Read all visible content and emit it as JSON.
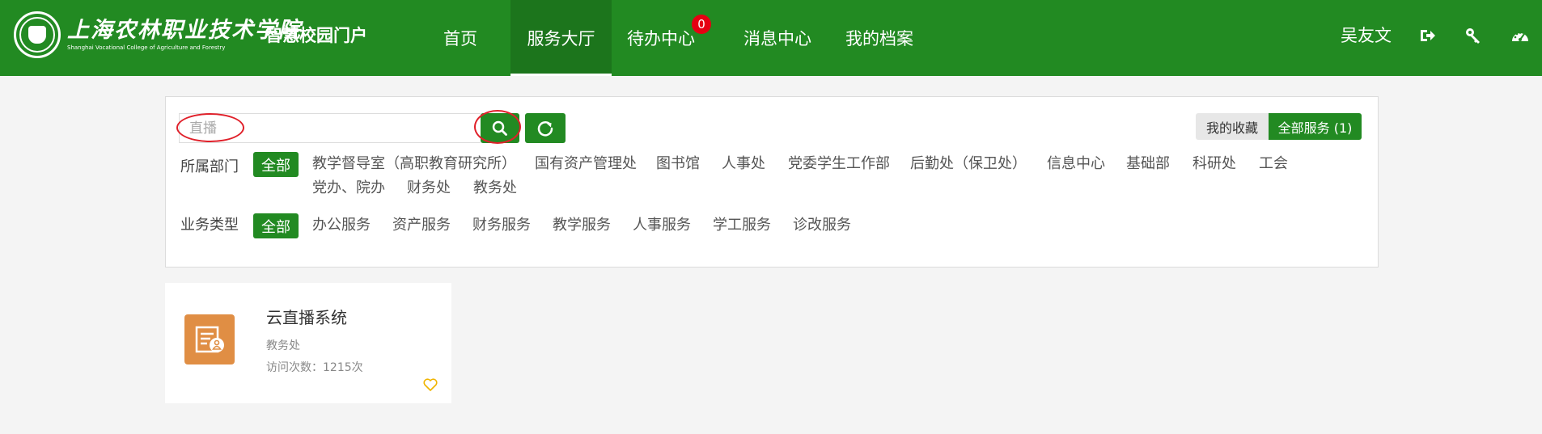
{
  "header": {
    "school_name_cn": "上海农林职业技术学院",
    "school_name_en": "Shanghai Vocational College of Agriculture and Forestry",
    "portal_name": "智慧校园门户",
    "nav": [
      {
        "label": "首页"
      },
      {
        "label": "服务大厅",
        "active": true
      },
      {
        "label": "待办中心",
        "badge": "0"
      },
      {
        "label": "消息中心"
      },
      {
        "label": "我的档案"
      }
    ],
    "user_name": "吴友文",
    "icons": [
      "logout-icon",
      "key-icon",
      "dashboard-icon"
    ],
    "brand_color": "#228a22",
    "badge_color": "#e60012"
  },
  "search": {
    "value": "",
    "placeholder": "直播"
  },
  "tabs": {
    "favorites": "我的收藏",
    "all_services": "全部服务 (1)"
  },
  "filters": {
    "department": {
      "label": "所属部门",
      "active": "全部",
      "options": [
        "教学督导室（高职教育研究所）",
        "国有资产管理处",
        "图书馆",
        "人事处",
        "党委学生工作部",
        "后勤处（保卫处）",
        "信息中心",
        "基础部",
        "科研处",
        "工会",
        "党办、院办",
        "财务处",
        "教务处"
      ]
    },
    "business_type": {
      "label": "业务类型",
      "active": "全部",
      "options": [
        "办公服务",
        "资产服务",
        "财务服务",
        "教学服务",
        "人事服务",
        "学工服务",
        "诊改服务"
      ]
    }
  },
  "services": [
    {
      "title": "云直播系统",
      "department": "教务处",
      "visits": "访问次数：1215次",
      "icon": "live-document-icon",
      "icon_color": "#e08e44"
    }
  ]
}
